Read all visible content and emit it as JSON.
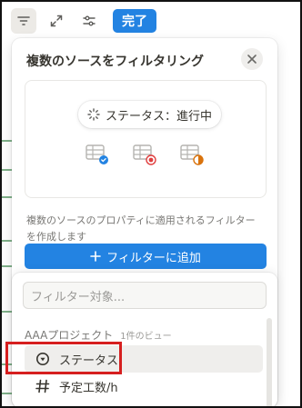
{
  "toolbar": {
    "icons": [
      "filter-icon",
      "expand-icon",
      "sliders-icon"
    ],
    "done_label": "完了"
  },
  "panel": {
    "title": "複数のソースをフィルタリング",
    "status_chip": "ステータス：進行中",
    "description": "複数のソースのプロパティに適用されるフィルターを作成します",
    "add_filter_label": "フィルターに追加"
  },
  "dropdown": {
    "search_placeholder": "フィルター対象...",
    "group_title": "AAAプロジェクト",
    "group_sub": "1件のビュー",
    "items": [
      {
        "label": "ステータス",
        "icon": "status-icon"
      },
      {
        "label": "予定工数/h",
        "icon": "hash-icon"
      }
    ]
  },
  "colors": {
    "accent": "#2383e2",
    "highlight": "#d61f1f",
    "badge_blue": "#2383e2",
    "badge_red": "#e03e3e",
    "badge_orange": "#d9730d"
  }
}
